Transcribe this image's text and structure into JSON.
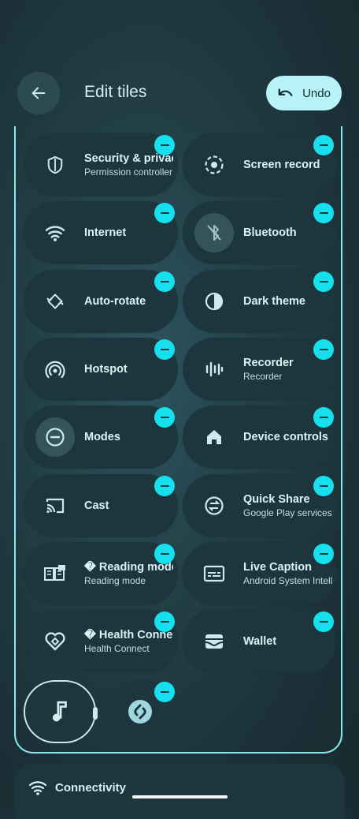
{
  "header": {
    "title": "Edit tiles",
    "undo_label": "Undo"
  },
  "tiles": [
    {
      "label": "Security & privacy",
      "sub": "Permission controller",
      "icon": "shield-icon"
    },
    {
      "label": "Screen record",
      "sub": "",
      "icon": "screen-record-icon"
    },
    {
      "label": "Internet",
      "sub": "",
      "icon": "wifi-icon"
    },
    {
      "label": "Bluetooth",
      "sub": "",
      "icon": "bluetooth-off-icon"
    },
    {
      "label": "Auto-rotate",
      "sub": "",
      "icon": "auto-rotate-icon"
    },
    {
      "label": "Dark theme",
      "sub": "",
      "icon": "dark-theme-icon"
    },
    {
      "label": "Hotspot",
      "sub": "",
      "icon": "hotspot-icon"
    },
    {
      "label": "Recorder",
      "sub": "Recorder",
      "icon": "recorder-waveform-icon"
    },
    {
      "label": "Modes",
      "sub": "",
      "icon": "modes-icon"
    },
    {
      "label": "Device controls",
      "sub": "",
      "icon": "home-icon"
    },
    {
      "label": "Cast",
      "sub": "",
      "icon": "cast-icon"
    },
    {
      "label": "Quick Share",
      "sub": "Google Play services",
      "icon": "quick-share-icon"
    },
    {
      "label": "� Reading mode",
      "sub": "Reading mode",
      "icon": "reading-mode-icon"
    },
    {
      "label": "Live Caption",
      "sub": "Android System Intelligence",
      "icon": "live-caption-icon"
    },
    {
      "label": "� Health Connect",
      "sub": "Health Connect",
      "icon": "health-connect-icon"
    },
    {
      "label": "Wallet",
      "sub": "",
      "icon": "wallet-icon"
    }
  ],
  "small_tiles": [
    {
      "icon": "music-note-icon"
    },
    {
      "icon": "shazam-icon"
    }
  ],
  "bottom": {
    "label": "Connectivity",
    "icon": "wifi-icon"
  }
}
